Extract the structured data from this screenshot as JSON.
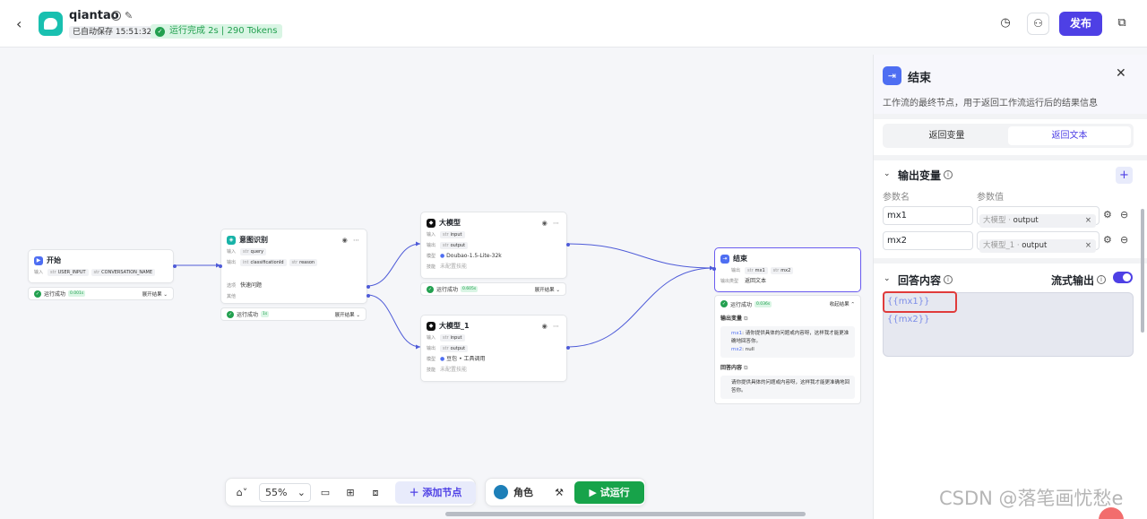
{
  "header": {
    "app_name": "qiantao",
    "autosave": "已自动保存 15:51:32",
    "run_status": "运行完成 2s | 290 Tokens",
    "publish_label": "发布"
  },
  "nodes": {
    "start": {
      "title": "开始",
      "input_label": "输入",
      "inputs": [
        "USER_INPUT",
        "CONVERSATION_NAME"
      ],
      "status": "运行成功",
      "time": "0.001s",
      "expand": "展开结果"
    },
    "intent": {
      "title": "意图识别",
      "input_label": "输入",
      "input_var": "query",
      "output_label": "输出",
      "outputs": [
        "classificationId",
        "reason"
      ],
      "option_label": "选项",
      "option_value": "快速问题",
      "other_label": "其他",
      "status": "运行成功",
      "time": "1s",
      "expand": "展开结果"
    },
    "llm": {
      "title": "大模型",
      "input_label": "输入",
      "input_var": "input",
      "output_label": "输出",
      "output_var": "output",
      "model_label": "模型",
      "model_value": "Doubao-1.5-Lite-32k",
      "skill_label": "技能",
      "skill_value": "未配置技能",
      "status": "运行成功",
      "time": "0.605s",
      "expand": "展开结果"
    },
    "llm1": {
      "title": "大模型_1",
      "input_label": "输入",
      "input_var": "input",
      "output_label": "输出",
      "output_var": "output",
      "model_label": "模型",
      "model_value": "豆包 • 工具调用",
      "skill_label": "技能",
      "skill_value": "未配置技能"
    },
    "end": {
      "title": "结束",
      "output_label": "输出",
      "outputs": [
        "mx1",
        "mx2"
      ],
      "type_label": "输出类型",
      "type_value": "返回文本",
      "status": "运行成功",
      "time": "0.036s",
      "collapse": "收起结果",
      "out_vars_title": "输出变量",
      "mx1_key": "mx1",
      "mx1_text": ": 请你提供具体的问题或内容呀，这样我才能更准确地回答你。",
      "mx2_key": "mx2",
      "mx2_text": ": null",
      "answer_title": "回答内容",
      "answer_text": "请你提供具体的问题或内容呀，这样我才能更准确地回答你。"
    }
  },
  "toolbar": {
    "zoom": "55%",
    "add_node": "添加节点",
    "role": "角色",
    "test_run": "试运行"
  },
  "panel": {
    "title": "结束",
    "description": "工作流的最终节点，用于返回工作流运行后的结果信息",
    "tabs": [
      "返回变量",
      "返回文本"
    ],
    "active_tab": "返回文本",
    "output_section": "输出变量",
    "col_name": "参数名",
    "col_value": "参数值",
    "vars": [
      {
        "name": "mx1",
        "source": "大模型",
        "field": "output"
      },
      {
        "name": "mx2",
        "source": "大模型_1",
        "field": "output"
      }
    ],
    "answer_section": "回答内容",
    "stream_label": "流式输出",
    "stream_on": true,
    "answer_template": "{{mx1}}{{mx2}}"
  },
  "watermark": "CSDN @落笔画忧愁e",
  "colors": {
    "accent": "#4e40e5",
    "success": "#22a04f",
    "run_button": "#17a34a",
    "highlight": "#e03b3b"
  }
}
